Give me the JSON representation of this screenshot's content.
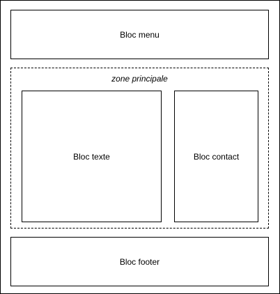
{
  "blocks": {
    "menu": "Bloc menu",
    "zone_title": "zone principale",
    "texte": "Bloc texte",
    "contact": "Bloc contact",
    "footer": "Bloc footer"
  }
}
